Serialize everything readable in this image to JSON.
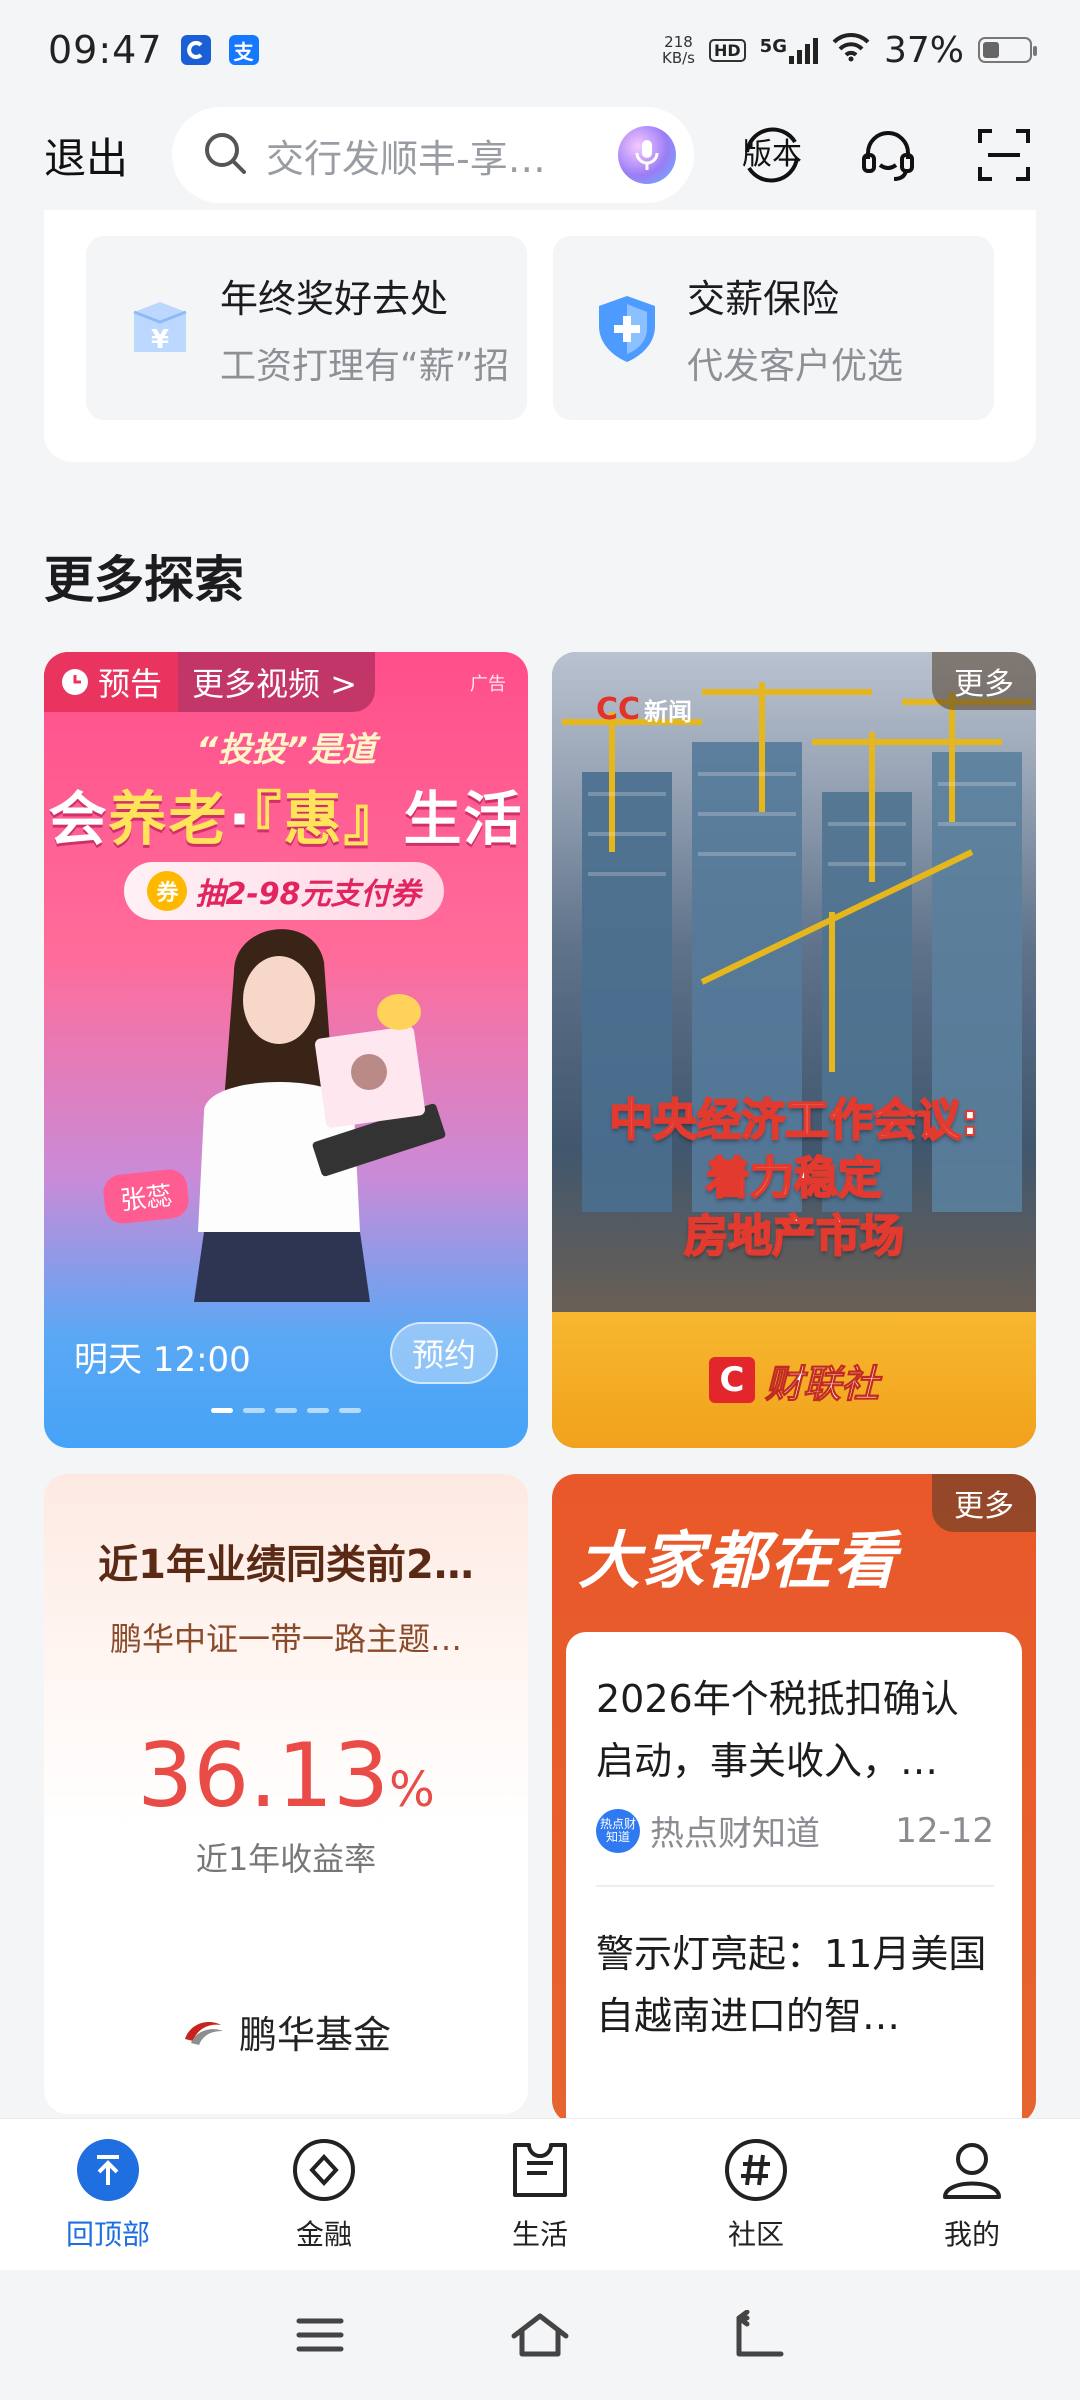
{
  "status_bar": {
    "time": "09:47",
    "net_speed_value": "218",
    "net_speed_unit": "KB/s",
    "hd": "HD",
    "network": "5G",
    "battery": "37%",
    "battery_level": 0.37
  },
  "top_bar": {
    "exit_label": "退出",
    "search_placeholder": "交行发顺丰-享…",
    "version_label": "版本"
  },
  "services": [
    {
      "title": "年终奖好去处",
      "subtitle": "工资打理有“薪”招",
      "icon": "yuan-box-icon"
    },
    {
      "title": "交薪保险",
      "subtitle": "代发客户优选",
      "icon": "shield-plus-icon"
    }
  ],
  "section_title": "更多探索",
  "ad_tile": {
    "badge": "预告",
    "more_videos": "更多视频 >",
    "ad_tag": "广告",
    "slogan": "“投投”是道",
    "headline_part1": "会",
    "headline_part2": "养老",
    "headline_part3": "·",
    "headline_part4": "『惠』",
    "headline_part5": "生活",
    "coupon_badge": "券",
    "coupon_text": "抽2-98元支付券",
    "presenter_name": "张蕊",
    "time": "明天 12:00",
    "reserve_label": "预约",
    "dots_total": 5,
    "dots_active": 0
  },
  "news_tile": {
    "logo_mark": "CC",
    "logo_text": "新闻",
    "more_label": "更多",
    "headline_lines": [
      "中央经济工作会议:",
      "着力稳定",
      "房地产市场"
    ],
    "source_mark": "C",
    "source": "财联社"
  },
  "fund_tile": {
    "title": "近1年业绩同类前2…",
    "fund_name": "鹏华中证一带一路主题…",
    "rate_value": "36.13",
    "rate_unit": "%",
    "rate_label": "近1年收益率",
    "company": "鹏华基金"
  },
  "hot_tile": {
    "title": "大家都在看",
    "more_label": "更多",
    "items": [
      {
        "title": "2026年个税抵扣确认启动，事关收入，…",
        "source_icon_text": "热点财知道",
        "source": "热点财知道",
        "date": "12-12"
      },
      {
        "title": "警示灯亮起：11月美国自越南进口的智…",
        "source": "",
        "date": ""
      }
    ]
  },
  "bottom_nav": [
    {
      "label": "回顶部",
      "icon": "back-to-top-icon",
      "active": true
    },
    {
      "label": "金融",
      "icon": "finance-diamond-icon",
      "active": false
    },
    {
      "label": "生活",
      "icon": "life-ticket-icon",
      "active": false
    },
    {
      "label": "社区",
      "icon": "community-hash-icon",
      "active": false
    },
    {
      "label": "我的",
      "icon": "profile-icon",
      "active": false
    }
  ],
  "colors": {
    "accent": "#1f6fe0",
    "ad_pink": "#ff4f8b",
    "fund_red": "#e94b46",
    "hot_orange": "#e9582a",
    "news_gold": "#f7b730"
  }
}
